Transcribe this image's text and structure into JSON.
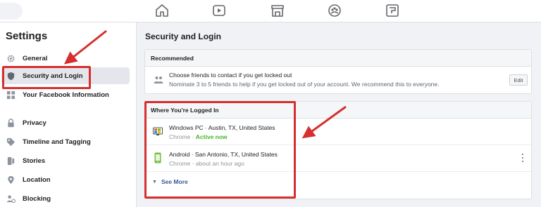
{
  "sidebar": {
    "title": "Settings",
    "items": [
      {
        "label": "General",
        "icon": "gear-icon"
      },
      {
        "label": "Security and Login",
        "icon": "shield-icon",
        "active": true
      },
      {
        "label": "Your Facebook Information",
        "icon": "facebook-info-icon"
      },
      {
        "label": "Privacy",
        "icon": "lock-icon"
      },
      {
        "label": "Timeline and Tagging",
        "icon": "tag-icon"
      },
      {
        "label": "Stories",
        "icon": "stories-icon"
      },
      {
        "label": "Location",
        "icon": "location-pin-icon"
      },
      {
        "label": "Blocking",
        "icon": "blocking-icon"
      }
    ]
  },
  "topnav": {
    "icons": [
      "home-icon",
      "watch-icon",
      "marketplace-icon",
      "groups-icon",
      "gaming-icon"
    ]
  },
  "main": {
    "title": "Security and Login",
    "recommended": {
      "heading": "Recommended",
      "line1": "Choose friends to contact if you get locked out",
      "line2": "Nominate 3 to 5 friends to help if you get locked out of your account. We recommend this to everyone.",
      "edit_label": "Edit"
    },
    "logged_in": {
      "heading": "Where You're Logged In",
      "sessions": [
        {
          "device": "Windows PC",
          "location": "Austin, TX, United States",
          "browser": "Chrome",
          "status": "Active now",
          "icon": "desktop-icon"
        },
        {
          "device": "Android",
          "location": "San Antonio, TX, United States",
          "browser": "Chrome",
          "status": "about an hour ago",
          "icon": "phone-icon"
        }
      ],
      "see_more_label": "See More"
    }
  },
  "colors": {
    "annotation_red": "#d62f2f",
    "active_green": "#42b72a",
    "link_blue": "#385898"
  }
}
